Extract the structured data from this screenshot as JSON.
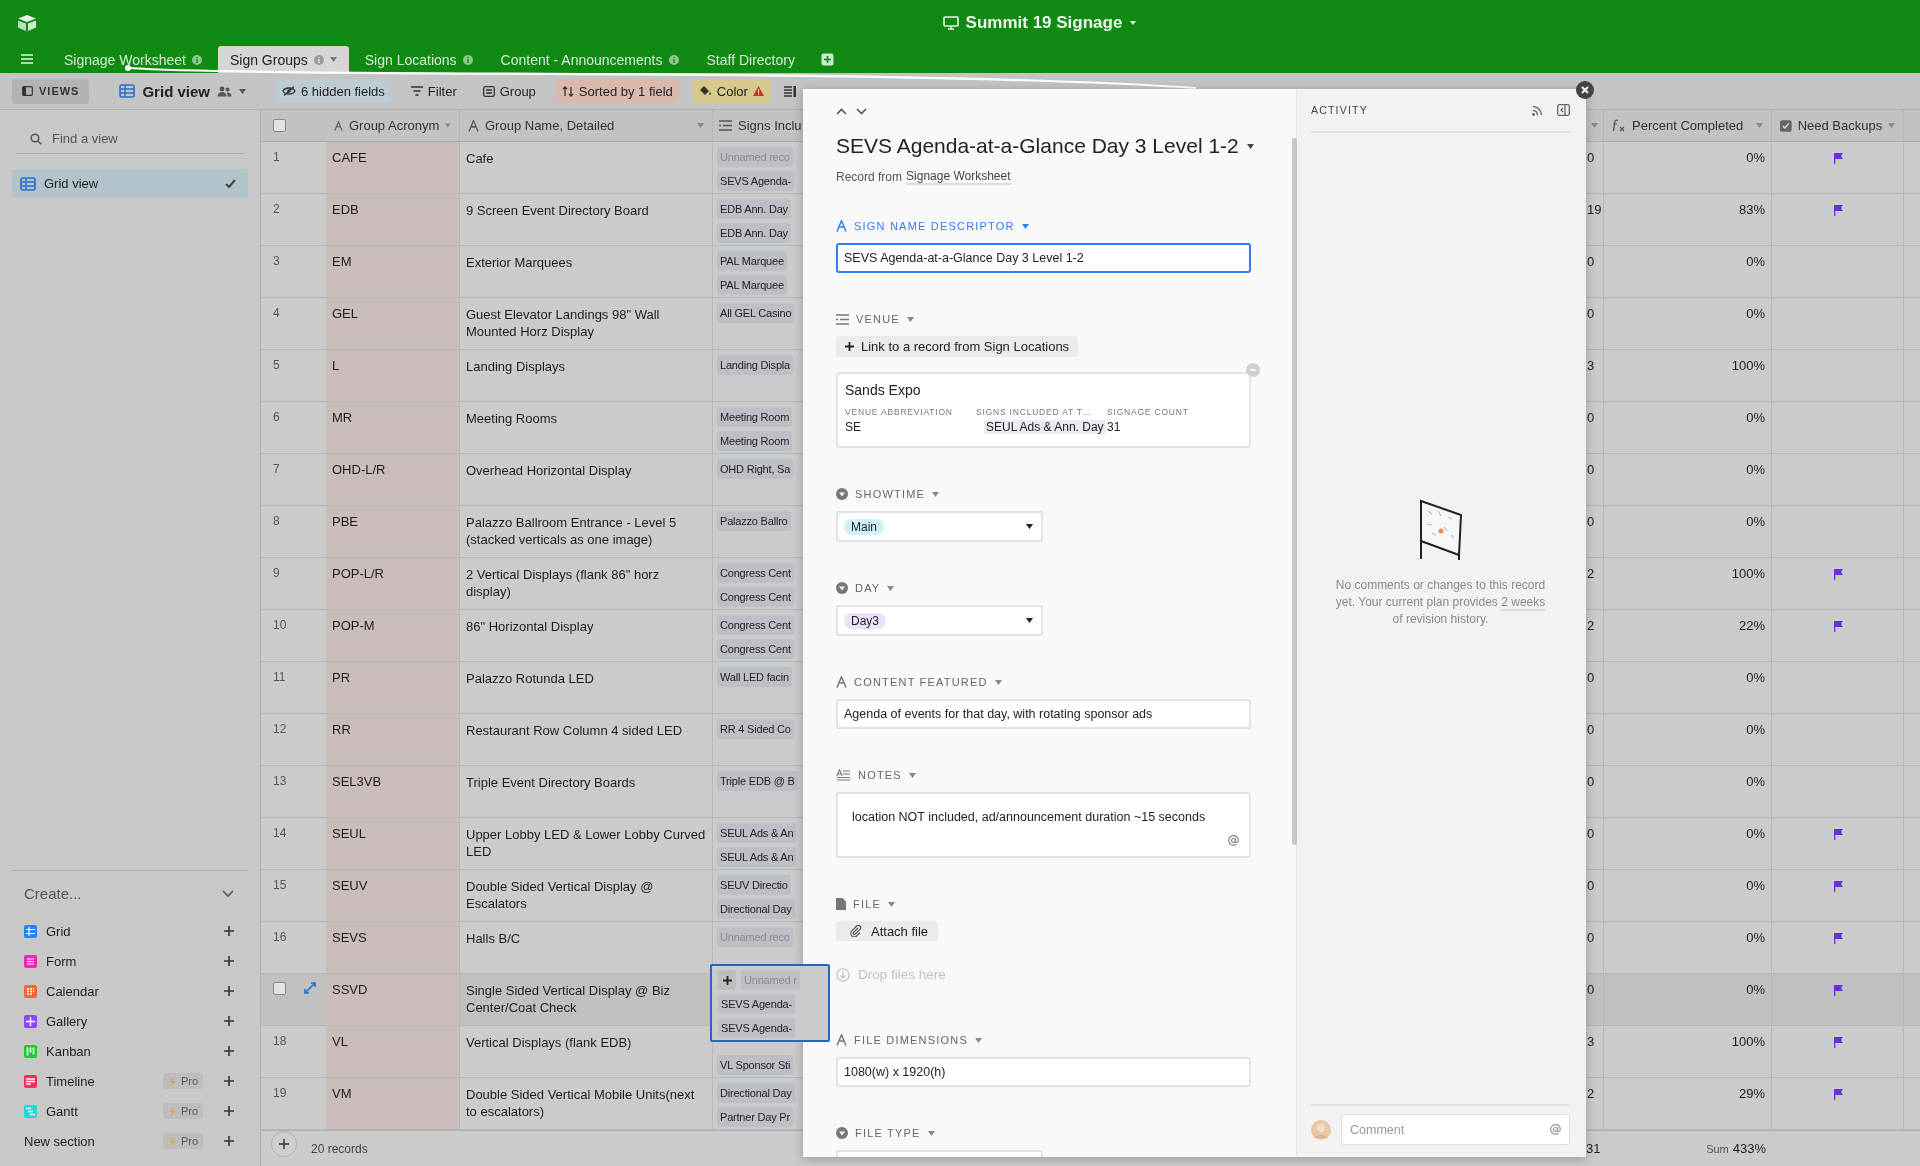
{
  "app": {
    "title": "Summit 19 Signage"
  },
  "tabs": [
    {
      "label": "Signage Worksheet",
      "selected": false,
      "info": true,
      "menu": false
    },
    {
      "label": "Sign Groups",
      "selected": true,
      "info": true,
      "menu": true
    },
    {
      "label": "Sign Locations",
      "selected": false,
      "info": true,
      "menu": false
    },
    {
      "label": "Content - Announcements",
      "selected": false,
      "info": true,
      "menu": false
    },
    {
      "label": "Staff Directory",
      "selected": false,
      "info": false,
      "menu": false
    }
  ],
  "toolbar": {
    "views_button": "VIEWS",
    "view_name": "Grid view",
    "items": [
      {
        "kind": "hidden",
        "label": "6 hidden fields",
        "color": "#bccbd4"
      },
      {
        "kind": "filter",
        "label": "Filter"
      },
      {
        "kind": "group",
        "label": "Group"
      },
      {
        "kind": "sort",
        "label": "Sorted by 1 field",
        "color": "#d9b9ae"
      },
      {
        "kind": "color",
        "label": "Color",
        "color": "#d6c98b",
        "warning": true
      },
      {
        "kind": "row-height"
      }
    ]
  },
  "sidebar": {
    "search": {
      "placeholder": "Find a view"
    },
    "views": [
      {
        "label": "Grid view",
        "selected": true
      }
    ],
    "create": {
      "label": "Create...",
      "items": [
        {
          "kind": "grid",
          "label": "Grid",
          "color": "#2d7ff9"
        },
        {
          "kind": "form",
          "label": "Form",
          "color": "#e929ba"
        },
        {
          "kind": "calendar",
          "label": "Calendar",
          "color": "#f7653b"
        },
        {
          "kind": "gallery",
          "label": "Gallery",
          "color": "#8b46ff"
        },
        {
          "kind": "kanban",
          "label": "Kanban",
          "color": "#20c933"
        },
        {
          "kind": "timeline",
          "label": "Timeline",
          "color": "#f82b60",
          "badge": "Pro"
        },
        {
          "kind": "gantt",
          "label": "Gantt",
          "color": "#20d9d2",
          "badge": "Pro"
        },
        {
          "kind": "section",
          "label": "New section",
          "badge": "Pro"
        }
      ]
    }
  },
  "grid": {
    "select_all": {
      "checked": false
    },
    "columns": {
      "acronym": "Group Acronym",
      "name": "Group Name, Detailed",
      "signs": "Signs Inclu",
      "percent": "Percent Completed",
      "backups": "Need Backups"
    },
    "rows": [
      {
        "number": "1",
        "hovered": false,
        "acronym": "CAFE",
        "name": "Cafe",
        "signs": [
          {
            "text": "Unnamed reco",
            "unnamed": true
          },
          {
            "text": "SEVS Agenda-",
            "unnamed": false
          }
        ],
        "count": "0",
        "percent": "0%",
        "flagged": true
      },
      {
        "number": "2",
        "hovered": false,
        "acronym": "EDB",
        "name": "9 Screen Event Directory Board",
        "signs": [
          {
            "text": "EDB Ann. Day",
            "unnamed": false
          },
          {
            "text": "EDB Ann. Day",
            "unnamed": false
          }
        ],
        "count": "19",
        "percent": "83%",
        "flagged": true
      },
      {
        "number": "3",
        "hovered": false,
        "acronym": "EM",
        "name": "Exterior Marquees",
        "signs": [
          {
            "text": "PAL Marquee",
            "unnamed": false
          },
          {
            "text": "PAL Marquee",
            "unnamed": false
          }
        ],
        "count": "0",
        "percent": "0%",
        "flagged": false
      },
      {
        "number": "4",
        "hovered": false,
        "acronym": "GEL",
        "name": "Guest Elevator Landings 98\" Wall Mounted Horz Display",
        "signs": [
          {
            "text": "All GEL Casino",
            "unnamed": false
          }
        ],
        "count": "0",
        "percent": "0%",
        "flagged": false
      },
      {
        "number": "5",
        "hovered": false,
        "acronym": "L",
        "name": "Landing Displays",
        "signs": [
          {
            "text": "Landing Displa",
            "unnamed": false
          }
        ],
        "count": "3",
        "percent": "100%",
        "flagged": false
      },
      {
        "number": "6",
        "hovered": false,
        "acronym": "MR",
        "name": "Meeting Rooms",
        "signs": [
          {
            "text": "Meeting Room",
            "unnamed": false
          },
          {
            "text": "Meeting Room",
            "unnamed": false
          }
        ],
        "count": "0",
        "percent": "0%",
        "flagged": false
      },
      {
        "number": "7",
        "hovered": false,
        "acronym": "OHD-L/R",
        "name": "Overhead Horizontal Display",
        "signs": [
          {
            "text": "OHD Right, Sa",
            "unnamed": false
          }
        ],
        "count": "0",
        "percent": "0%",
        "flagged": false
      },
      {
        "number": "8",
        "hovered": false,
        "acronym": "PBE",
        "name": "Palazzo Ballroom Entrance - Level 5 (stacked verticals as one image)",
        "signs": [
          {
            "text": "Palazzo Ballro",
            "unnamed": false
          }
        ],
        "count": "0",
        "percent": "0%",
        "flagged": false
      },
      {
        "number": "9",
        "hovered": false,
        "acronym": "POP-L/R",
        "name": "2 Vertical Displays (flank 86\" horz display)",
        "signs": [
          {
            "text": "Congress Cent",
            "unnamed": false
          },
          {
            "text": "Congress Cent",
            "unnamed": false
          }
        ],
        "count": "2",
        "percent": "100%",
        "flagged": true
      },
      {
        "number": "10",
        "hovered": false,
        "acronym": "POP-M",
        "name": "86\" Horizontal Display",
        "signs": [
          {
            "text": "Congress Cent",
            "unnamed": false
          },
          {
            "text": "Congress Cent",
            "unnamed": false
          }
        ],
        "count": "2",
        "percent": "22%",
        "flagged": true
      },
      {
        "number": "11",
        "hovered": false,
        "acronym": "PR",
        "name": "Palazzo Rotunda LED",
        "signs": [
          {
            "text": "Wall LED facin",
            "unnamed": false
          }
        ],
        "count": "0",
        "percent": "0%",
        "flagged": false
      },
      {
        "number": "12",
        "hovered": false,
        "acronym": "RR",
        "name": "Restaurant Row Column 4 sided LED",
        "signs": [
          {
            "text": "RR 4 Sided Co",
            "unnamed": false
          }
        ],
        "count": "0",
        "percent": "0%",
        "flagged": false
      },
      {
        "number": "13",
        "hovered": false,
        "acronym": "SEL3VB",
        "name": "Triple Event Directory Boards",
        "signs": [
          {
            "text": "Triple EDB @ B",
            "unnamed": false
          }
        ],
        "count": "0",
        "percent": "0%",
        "flagged": false
      },
      {
        "number": "14",
        "hovered": false,
        "acronym": "SEUL",
        "name": "Upper Lobby LED & Lower Lobby Curved LED",
        "signs": [
          {
            "text": "SEUL Ads & An",
            "unnamed": false
          },
          {
            "text": "SEUL Ads & An",
            "unnamed": false
          }
        ],
        "count": "0",
        "percent": "0%",
        "flagged": true
      },
      {
        "number": "15",
        "hovered": false,
        "acronym": "SEUV",
        "name": "Double Sided Vertical Display @ Escalators",
        "signs": [
          {
            "text": "SEUV Directio",
            "unnamed": false
          },
          {
            "text": "Directional Day",
            "unnamed": false
          }
        ],
        "count": "0",
        "percent": "0%",
        "flagged": true
      },
      {
        "number": "16",
        "hovered": false,
        "acronym": "SEVS",
        "name": "Halls B/C",
        "signs": [
          {
            "text": "Unnamed reco",
            "unnamed": true
          }
        ],
        "count": "0",
        "percent": "0%",
        "flagged": true
      },
      {
        "hovered": true,
        "checked": false,
        "editing": true,
        "acronym": "SSVD",
        "name": "Single Sided Vertical Display @ Biz Center/Coat Check",
        "signs": [
          {
            "text": "Unnamed r",
            "unnamed": true
          },
          {
            "text": "SEVS Agenda-",
            "unnamed": false
          },
          {
            "text": "SEVS Agenda-",
            "unnamed": false
          }
        ],
        "count": "0",
        "percent": "0%",
        "flagged": true
      },
      {
        "number": "18",
        "hovered": false,
        "acronym": "VL",
        "name": "Vertical Displays (flank EDB)",
        "signs": [
          {
            "text": "VL Sponsor Sti",
            "unnamed": false
          }
        ],
        "count": "3",
        "percent": "100%",
        "flagged": true
      },
      {
        "number": "19",
        "hovered": false,
        "acronym": "VM",
        "name": "Double Sided Vertical Mobile Units(next to escalators)",
        "signs": [
          {
            "text": "Directional Day",
            "unnamed": false
          },
          {
            "text": "Partner Day Pr",
            "unnamed": false
          }
        ],
        "count": "2",
        "percent": "29%",
        "flagged": true
      }
    ],
    "footer": {
      "records": "20 records",
      "count_total": "31",
      "sum_label": "Sum",
      "sum": "433%"
    }
  },
  "record": {
    "title": "SEVS Agenda-at-a-Glance Day 3 Level 1-2",
    "source_prefix": "Record from",
    "source": "Signage Worksheet",
    "fields": [
      {
        "kind": "text",
        "label": "SIGN NAME DESCRIPTOR",
        "focused": true,
        "value": "SEVS Agenda-at-a-Glance Day 3 Level 1-2"
      },
      {
        "kind": "link",
        "label": "VENUE",
        "button": "Link to a record from Sign Locations",
        "card": {
          "title": "Sands Expo",
          "fields": [
            {
              "label": "VENUE ABBREVIATION",
              "value": "SE",
              "chip": false
            },
            {
              "label": "SIGNS INCLUDED AT T…",
              "value": "SEUL Ads & Ann. Day",
              "chip": true
            },
            {
              "label": "SIGNAGE COUNT",
              "value": "31",
              "chip": false
            }
          ]
        }
      },
      {
        "kind": "select",
        "label": "SHOWTIME",
        "value": "Main",
        "color": "#d0f0fd"
      },
      {
        "kind": "select",
        "label": "DAY",
        "value": "Day3",
        "color": "#ede2fe"
      },
      {
        "kind": "text",
        "label": "CONTENT FEATURED",
        "focused": false,
        "value": "Agenda of events for that day, with rotating sponsor ads"
      },
      {
        "kind": "long-text",
        "label": "NOTES",
        "value": "location NOT included, ad/announcement duration ~15 seconds"
      },
      {
        "kind": "attachment",
        "label": "FILE",
        "button": "Attach file",
        "drop_hint": "Drop files here"
      },
      {
        "kind": "text",
        "label": "FILE DIMENSIONS",
        "focused": false,
        "value": "1080(w) x 1920(h)"
      },
      {
        "kind": "select",
        "label": "FILE TYPE"
      }
    ]
  },
  "activity": {
    "title": "ACTIVITY",
    "message_before": "No comments or changes to this record yet. Your current plan provides",
    "link": "2 weeks",
    "message_after": "of revision history.",
    "comment": {
      "placeholder": "Comment"
    }
  }
}
